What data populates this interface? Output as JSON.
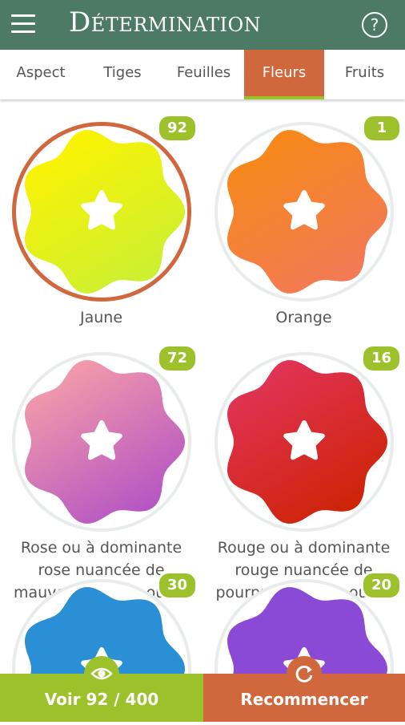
{
  "header": {
    "title": "Détermination",
    "menu_icon": "hamburger-icon",
    "help_icon": "help-icon",
    "help_glyph": "?"
  },
  "tabs": [
    {
      "label": "Aspect"
    },
    {
      "label": "Tiges"
    },
    {
      "label": "Feuilles"
    },
    {
      "label": "Fleurs",
      "active": true
    },
    {
      "label": "Fruits"
    }
  ],
  "options": [
    {
      "count": "92",
      "label": "Jaune",
      "selected": true,
      "colors": [
        "#fff200",
        "#c8f035"
      ]
    },
    {
      "count": "1",
      "label": "Orange",
      "selected": false,
      "colors": [
        "#f78a14",
        "#f2785c"
      ]
    },
    {
      "count": "72",
      "label": "Rose ou à dominante rose nuancée de mauve, de violet ou de pourpre",
      "selected": false,
      "colors": [
        "#f7a0a8",
        "#b04fc6"
      ]
    },
    {
      "count": "16",
      "label": "Rouge ou à dominante rouge nuancée de pourpre, de brun ou de vert",
      "selected": false,
      "colors": [
        "#e2345c",
        "#cc2200"
      ]
    },
    {
      "count": "30",
      "label": "",
      "selected": false,
      "colors": [
        "#2a8fd4",
        "#2a8fd4"
      ]
    },
    {
      "count": "20",
      "label": "",
      "selected": false,
      "colors": [
        "#8a4ad6",
        "#8a4ad6"
      ]
    }
  ],
  "footer": {
    "voir_label": "Voir 92 / 400",
    "voir_icon": "eye-icon",
    "recommencer_label": "Recommencer",
    "recommencer_icon": "refresh-icon"
  },
  "colors": {
    "header": "#4c7a65",
    "accent_orange": "#d0673d",
    "accent_green": "#9cc12b"
  }
}
